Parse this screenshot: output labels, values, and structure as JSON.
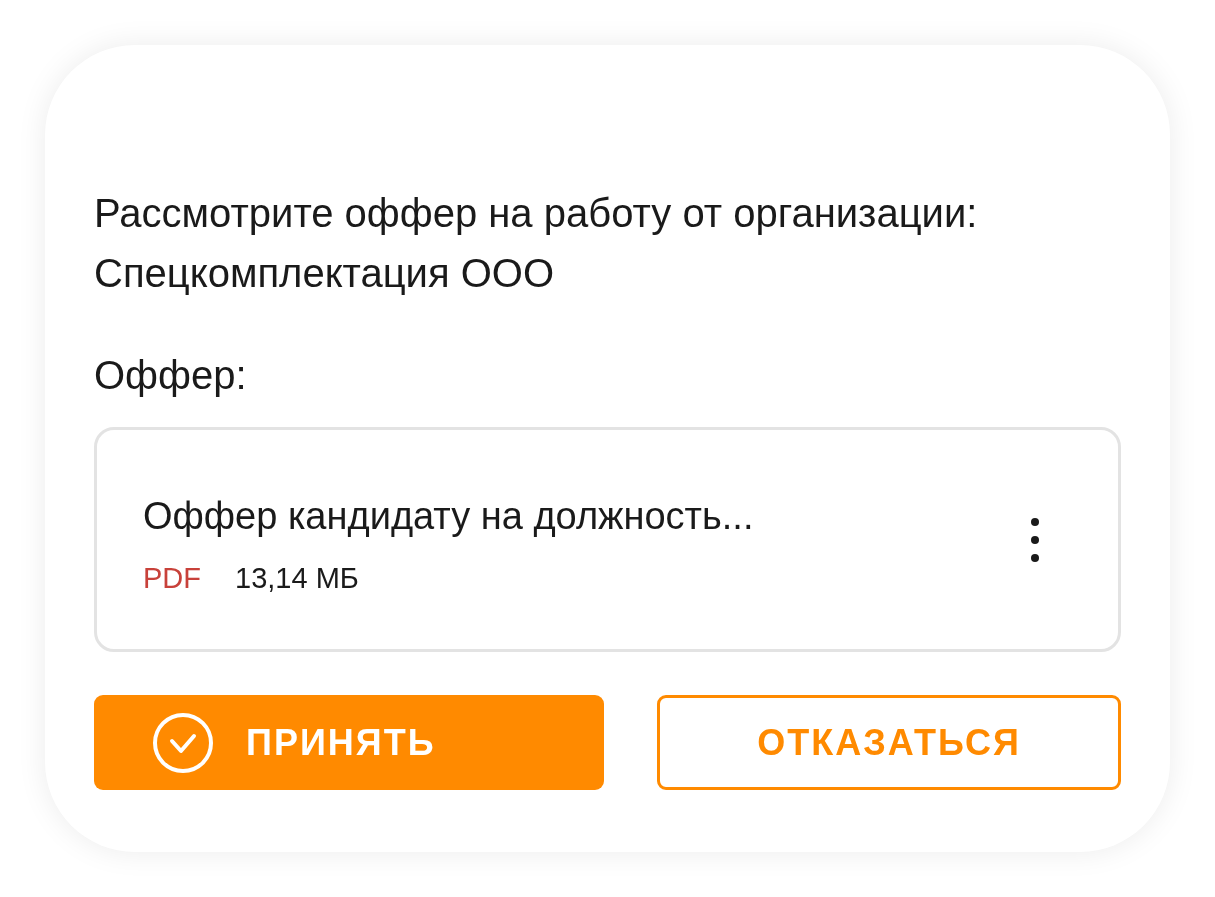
{
  "message": "Рассмотрите оффер на работу от организации: Спецкомплектация ООО",
  "offer_label": "Оффер:",
  "file": {
    "name": "Оффер кандидату на должность...",
    "type": "PDF",
    "size": "13,14 МБ"
  },
  "buttons": [
    {
      "label": "ПРИНЯТЬ",
      "kind": "primary"
    },
    {
      "label": "ОТКАЗАТЬСЯ",
      "kind": "outline"
    }
  ]
}
